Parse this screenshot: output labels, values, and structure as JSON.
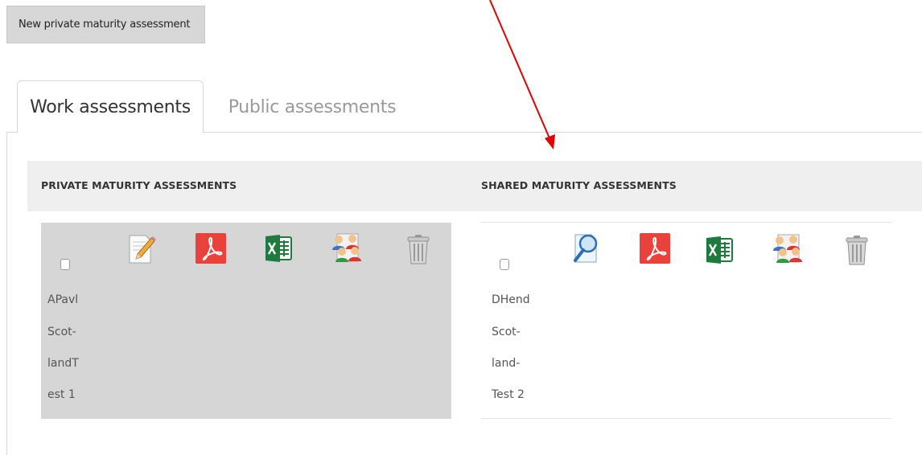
{
  "toolbar": {
    "new_button_label": "New private maturity assessment"
  },
  "tabs": [
    {
      "label": "Work assessments",
      "active": true
    },
    {
      "label": "Public assessments",
      "active": false
    }
  ],
  "columns": {
    "private": {
      "title": "PRIVATE MATURITY ASSESSMENTS",
      "item": {
        "name_lines": [
          "APavl",
          "Scot-",
          "landT",
          "est 1"
        ],
        "actions": [
          "edit-pencil-icon",
          "pdf-icon",
          "excel-icon",
          "share-users-icon",
          "trash-icon"
        ]
      }
    },
    "shared": {
      "title": "SHARED MATURITY ASSESSMENTS",
      "item": {
        "name_lines": [
          "DHend",
          "Scot-",
          "land-",
          "Test 2"
        ],
        "actions": [
          "view-magnifier-icon",
          "pdf-icon",
          "excel-icon",
          "share-users-icon",
          "trash-icon"
        ]
      }
    }
  },
  "colors": {
    "annotation_arrow": "#e00000",
    "pdf": "#e8423b",
    "excel": "#1f7a3e"
  }
}
